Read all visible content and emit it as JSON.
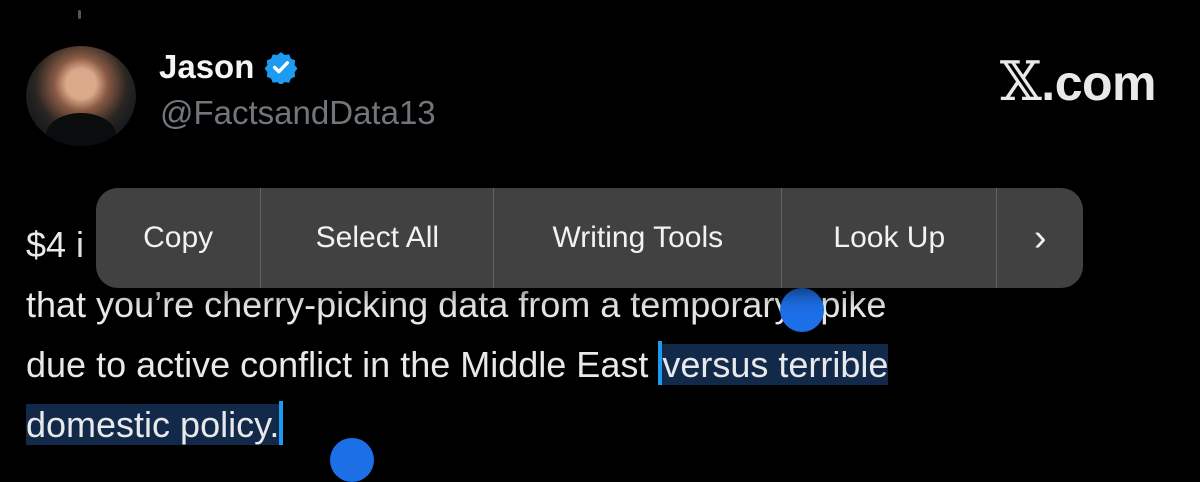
{
  "author": {
    "name": "Jason",
    "handle": "@FactsandData13",
    "verified_color": "#1d9bf0"
  },
  "brand": {
    "logo_x": "𝕏",
    "logo_suffix": ".com"
  },
  "tweet": {
    "line1_prefix": "$4 i",
    "line2": "that you’re cherry-picking data from a temporary spike",
    "line3_plain": "due to active conflict in the Middle East ",
    "line3_selected": "versus terrible",
    "line4_selected": "domestic policy."
  },
  "context_menu": {
    "items": [
      "Copy",
      "Select All",
      "Writing Tools",
      "Look Up",
      "›"
    ]
  },
  "colors": {
    "background": "#000000",
    "selection": "#13294a",
    "selection_handle": "#1d6fe8",
    "menu_bg": "#464648"
  }
}
